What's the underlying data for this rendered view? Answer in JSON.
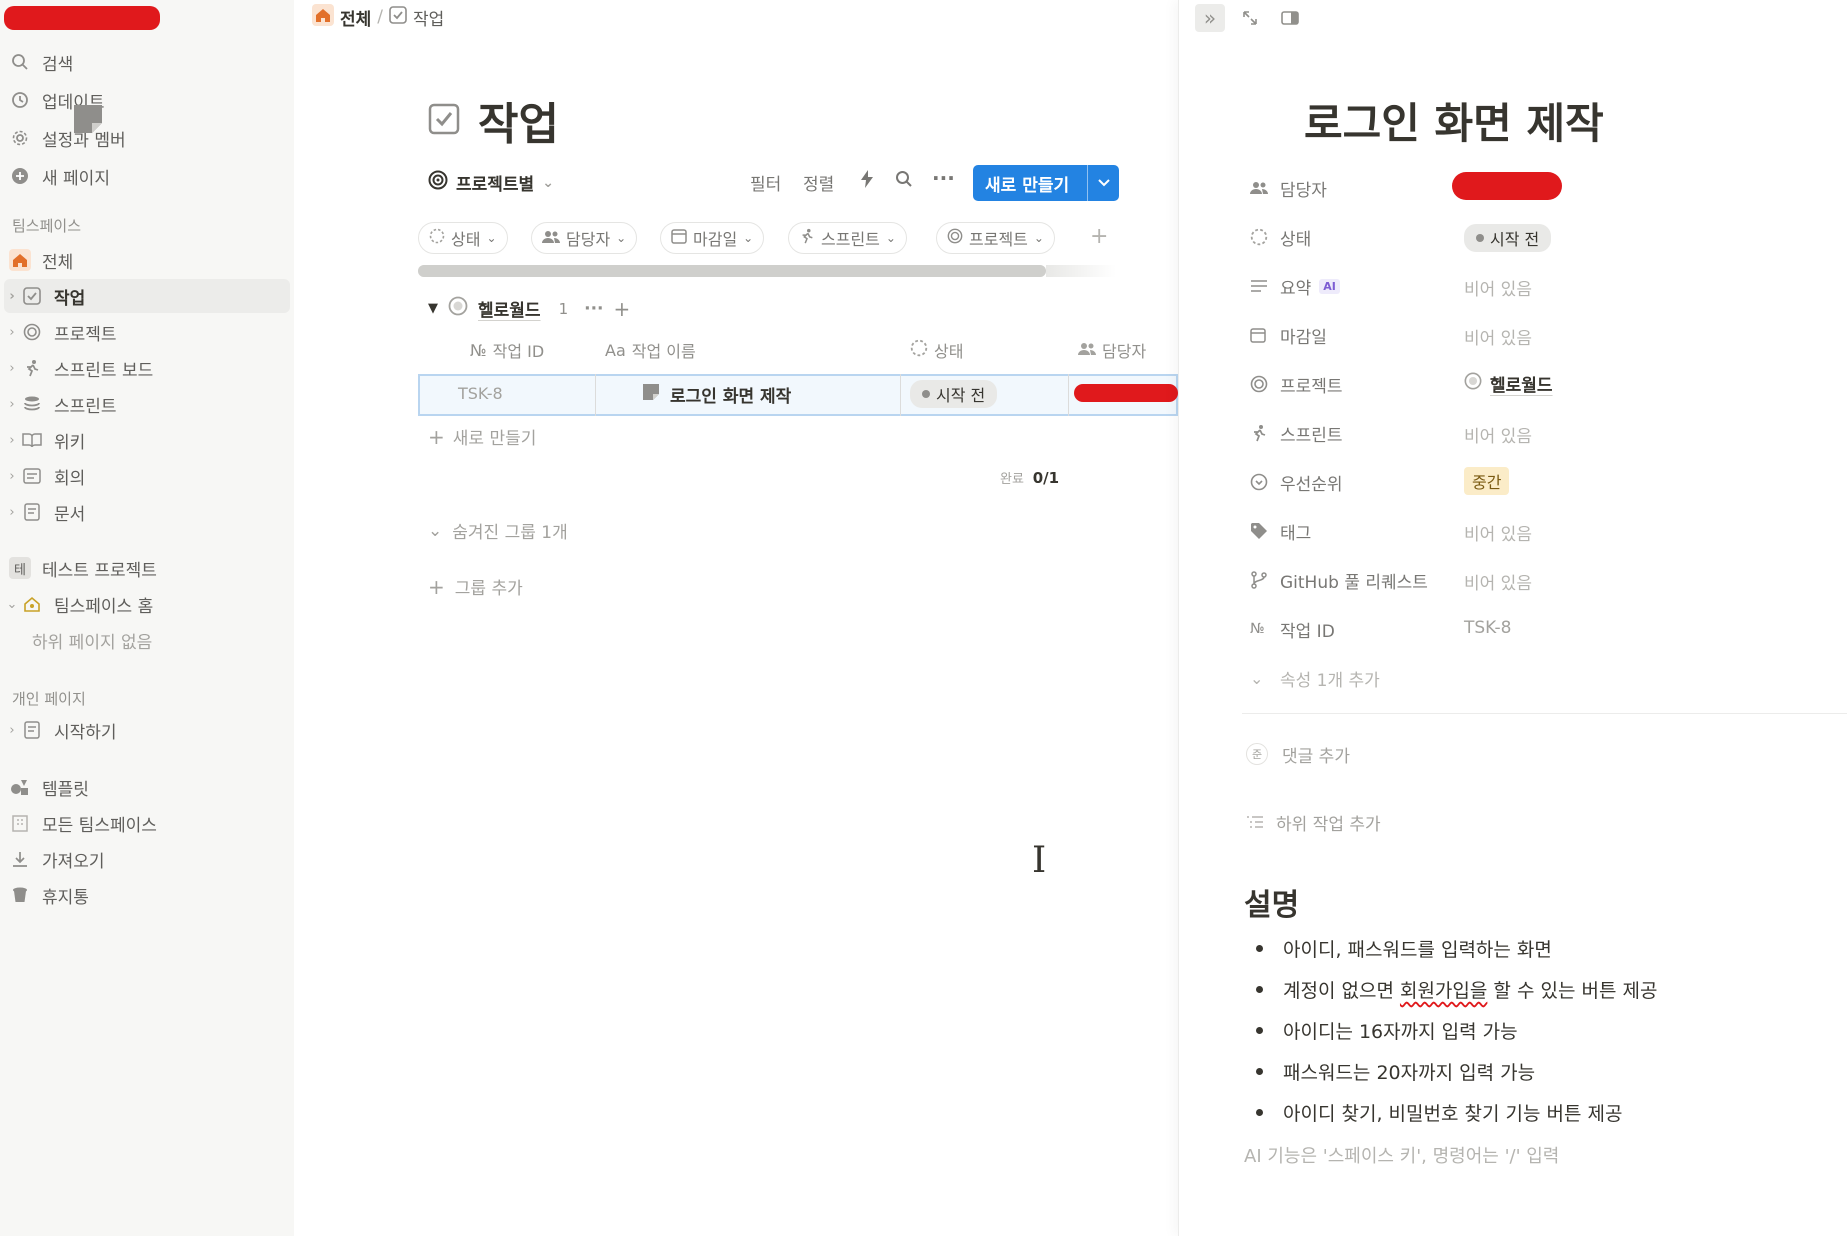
{
  "sidebar": {
    "top_items": [
      {
        "label": "검색",
        "icon": "search-icon"
      },
      {
        "label": "업데이트",
        "icon": "clock-icon"
      },
      {
        "label": "설정과 멤버",
        "icon": "gear-icon"
      },
      {
        "label": "새 페이지",
        "icon": "plus-circle-icon"
      }
    ],
    "teamspace_header": "팀스페이스",
    "teamspace_items": [
      {
        "label": "전체",
        "icon": "home-icon"
      },
      {
        "label": "작업",
        "icon": "checkbox-icon"
      },
      {
        "label": "프로젝트",
        "icon": "target-icon"
      },
      {
        "label": "스프린트 보드",
        "icon": "runner-icon"
      },
      {
        "label": "스프린트",
        "icon": "database-icon"
      },
      {
        "label": "위키",
        "icon": "book-icon"
      },
      {
        "label": "회의",
        "icon": "note-icon"
      },
      {
        "label": "문서",
        "icon": "document-icon"
      }
    ],
    "test_project": {
      "badge": "테",
      "label": "테스트 프로젝트"
    },
    "team_home": {
      "label": "팀스페이스 홈",
      "icon": "home-person-icon"
    },
    "no_subpages": "하위 페이지 없음",
    "personal_header": "개인 페이지",
    "personal_items": [
      {
        "label": "시작하기",
        "icon": "document-icon"
      }
    ],
    "bottom_items": [
      {
        "label": "템플릿",
        "icon": "shapes-icon"
      },
      {
        "label": "모든 팀스페이스",
        "icon": "building-icon"
      },
      {
        "label": "가져오기",
        "icon": "download-icon"
      },
      {
        "label": "휴지통",
        "icon": "trash-icon"
      }
    ]
  },
  "breadcrumb": {
    "home": "전체",
    "sep": "/",
    "current": "작업"
  },
  "page": {
    "title": "작업",
    "view_label": "프로젝트별",
    "toolbar": {
      "filter": "필터",
      "sort": "정렬",
      "new_button": "새로 만들기"
    },
    "filter_chips": [
      "상태",
      "담당자",
      "마감일",
      "스프린트",
      "프로젝트"
    ],
    "group": {
      "name": "헬로월드",
      "count": "1"
    },
    "columns": [
      "작업 ID",
      "작업 이름",
      "상태",
      "담당자"
    ],
    "column_prefix": {
      "id": "№",
      "name": "Aa"
    },
    "rows": [
      {
        "id": "TSK-8",
        "name": "로그인 화면 제작",
        "status": "시작 전"
      }
    ],
    "new_row": "새로 만들기",
    "done_label": "완료",
    "done_count": "0/1",
    "hidden_groups": "숨겨진 그룹 1개",
    "add_group": "그룹 추가"
  },
  "peek": {
    "title": "로그인 화면 제작",
    "properties": [
      {
        "label": "담당자",
        "icon": "people-icon",
        "value": ""
      },
      {
        "label": "상태",
        "icon": "status-icon",
        "value": "시작 전"
      },
      {
        "label": "요약",
        "icon": "lines-icon",
        "value": "비어 있음",
        "ai": "AI"
      },
      {
        "label": "마감일",
        "icon": "calendar-icon",
        "value": "비어 있음"
      },
      {
        "label": "프로젝트",
        "icon": "target-icon",
        "value": "헬로월드"
      },
      {
        "label": "스프린트",
        "icon": "runner-icon",
        "value": "비어 있음"
      },
      {
        "label": "우선순위",
        "icon": "priority-icon",
        "value": "중간"
      },
      {
        "label": "태그",
        "icon": "tag-icon",
        "value": "비어 있음"
      },
      {
        "label": "GitHub 풀 리퀘스트",
        "icon": "branch-icon",
        "value": "비어 있음"
      },
      {
        "label": "작업 ID",
        "icon": "number-icon",
        "value": "TSK-8"
      }
    ],
    "add_property": "속성 1개 추가",
    "add_comment": "댓글 추가",
    "add_subtask": "하위 작업 추가",
    "description_heading": "설명",
    "bullets": [
      "아이디, 패스워드를 입력하는 화면",
      "계정이 없으면",
      "회원가입을",
      "할 수 있는 버튼 제공",
      "아이디는 16자까지 입력 가능",
      "패스워드는 20자까지 입력 가능",
      "아이디 찾기, 비밀번호 찾기 기능 버튼 제공"
    ],
    "placeholder": "AI 기능은 '스페이스 키', 명령어는 '/' 입력"
  },
  "colors": {
    "accent": "#2383e2",
    "redaction": "#e0191c",
    "priority_bg": "#fbecc8",
    "sidebar_bg": "#f7f7f5"
  }
}
